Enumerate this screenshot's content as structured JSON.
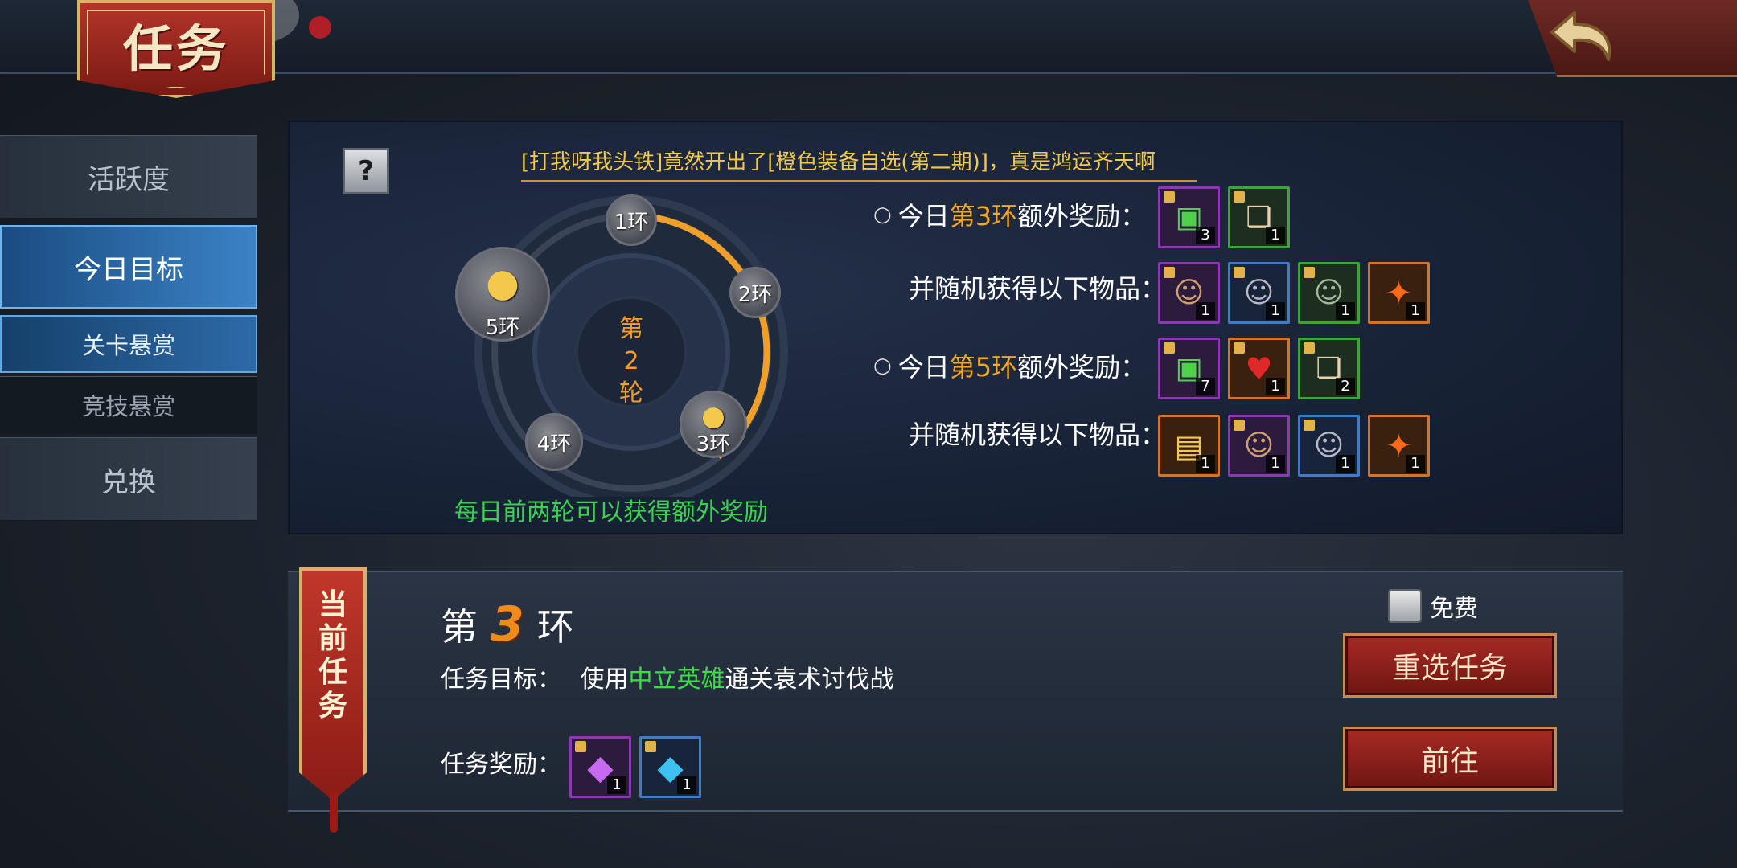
{
  "header": {
    "title": "任务"
  },
  "sidebar": {
    "items": [
      {
        "label": "活跃度"
      },
      {
        "label": "今日目标"
      },
      {
        "label": "关卡悬赏"
      },
      {
        "label": "竞技悬赏"
      },
      {
        "label": "兑换"
      }
    ],
    "active_index": 1,
    "active_sub_index": 2
  },
  "info": {
    "help_label": "?",
    "announcement": "[打我呀我头铁]竟然开出了[橙色装备自选(第二期)]，真是鸿运齐天啊",
    "wheel": {
      "rings": [
        "1环",
        "2环",
        "3环",
        "4环",
        "5环"
      ],
      "round_chars": [
        "第",
        "2",
        "轮"
      ],
      "note": "每日前两轮可以获得额外奖励"
    },
    "reward3": {
      "bullet": "○",
      "prefix": "今日",
      "highlight": "第3环",
      "suffix": "额外奖励：",
      "items": [
        {
          "icon": "gift-box-icon",
          "count": "3",
          "rarity": "purple"
        },
        {
          "icon": "scroll-icon",
          "count": "1",
          "rarity": "green"
        }
      ]
    },
    "random3": {
      "label": "并随机获得以下物品：",
      "items": [
        {
          "icon": "hero-portrait-icon",
          "count": "1",
          "rarity": "purple"
        },
        {
          "icon": "hero-portrait-icon",
          "count": "1",
          "rarity": "blue"
        },
        {
          "icon": "hero-portrait-icon",
          "count": "1",
          "rarity": "green"
        },
        {
          "icon": "fire-crystal-icon",
          "count": "1",
          "rarity": "orange"
        }
      ]
    },
    "reward5": {
      "bullet": "○",
      "prefix": "今日",
      "highlight": "第5环",
      "suffix": "额外奖励：",
      "items": [
        {
          "icon": "gift-box-icon",
          "count": "7",
          "rarity": "purple"
        },
        {
          "icon": "red-potion-icon",
          "count": "1",
          "rarity": "orange"
        },
        {
          "icon": "scroll-icon",
          "count": "2",
          "rarity": "green"
        }
      ]
    },
    "random5": {
      "label": "并随机获得以下物品：",
      "items": [
        {
          "icon": "gold-card-icon",
          "count": "1",
          "rarity": "orange"
        },
        {
          "icon": "hero-portrait-icon",
          "count": "1",
          "rarity": "purple"
        },
        {
          "icon": "hero-portrait-icon",
          "count": "1",
          "rarity": "blue"
        },
        {
          "icon": "fire-crystal-icon",
          "count": "1",
          "rarity": "orange"
        }
      ]
    }
  },
  "task": {
    "banner": [
      "当",
      "前",
      "任",
      "务"
    ],
    "ring_prefix": "第",
    "ring_number": "3",
    "ring_suffix": "环",
    "goal_label": "任务目标：",
    "goal_pre": "使用",
    "goal_highlight": "中立英雄",
    "goal_post": "通关袁术讨伐战",
    "reward_label": "任务奖励：",
    "reward_items": [
      {
        "icon": "purple-gem-icon",
        "count": "1",
        "rarity": "purple"
      },
      {
        "icon": "blue-gem-icon",
        "count": "1",
        "rarity": "blue"
      }
    ],
    "free_label": "免费",
    "reselect_label": "重选任务",
    "goto_label": "前往"
  },
  "colors": {
    "accent_orange": "#f5a623",
    "accent_green": "#3fdc4a",
    "accent_red": "#a82a24",
    "active_tab_blue": "#3b83c6"
  }
}
